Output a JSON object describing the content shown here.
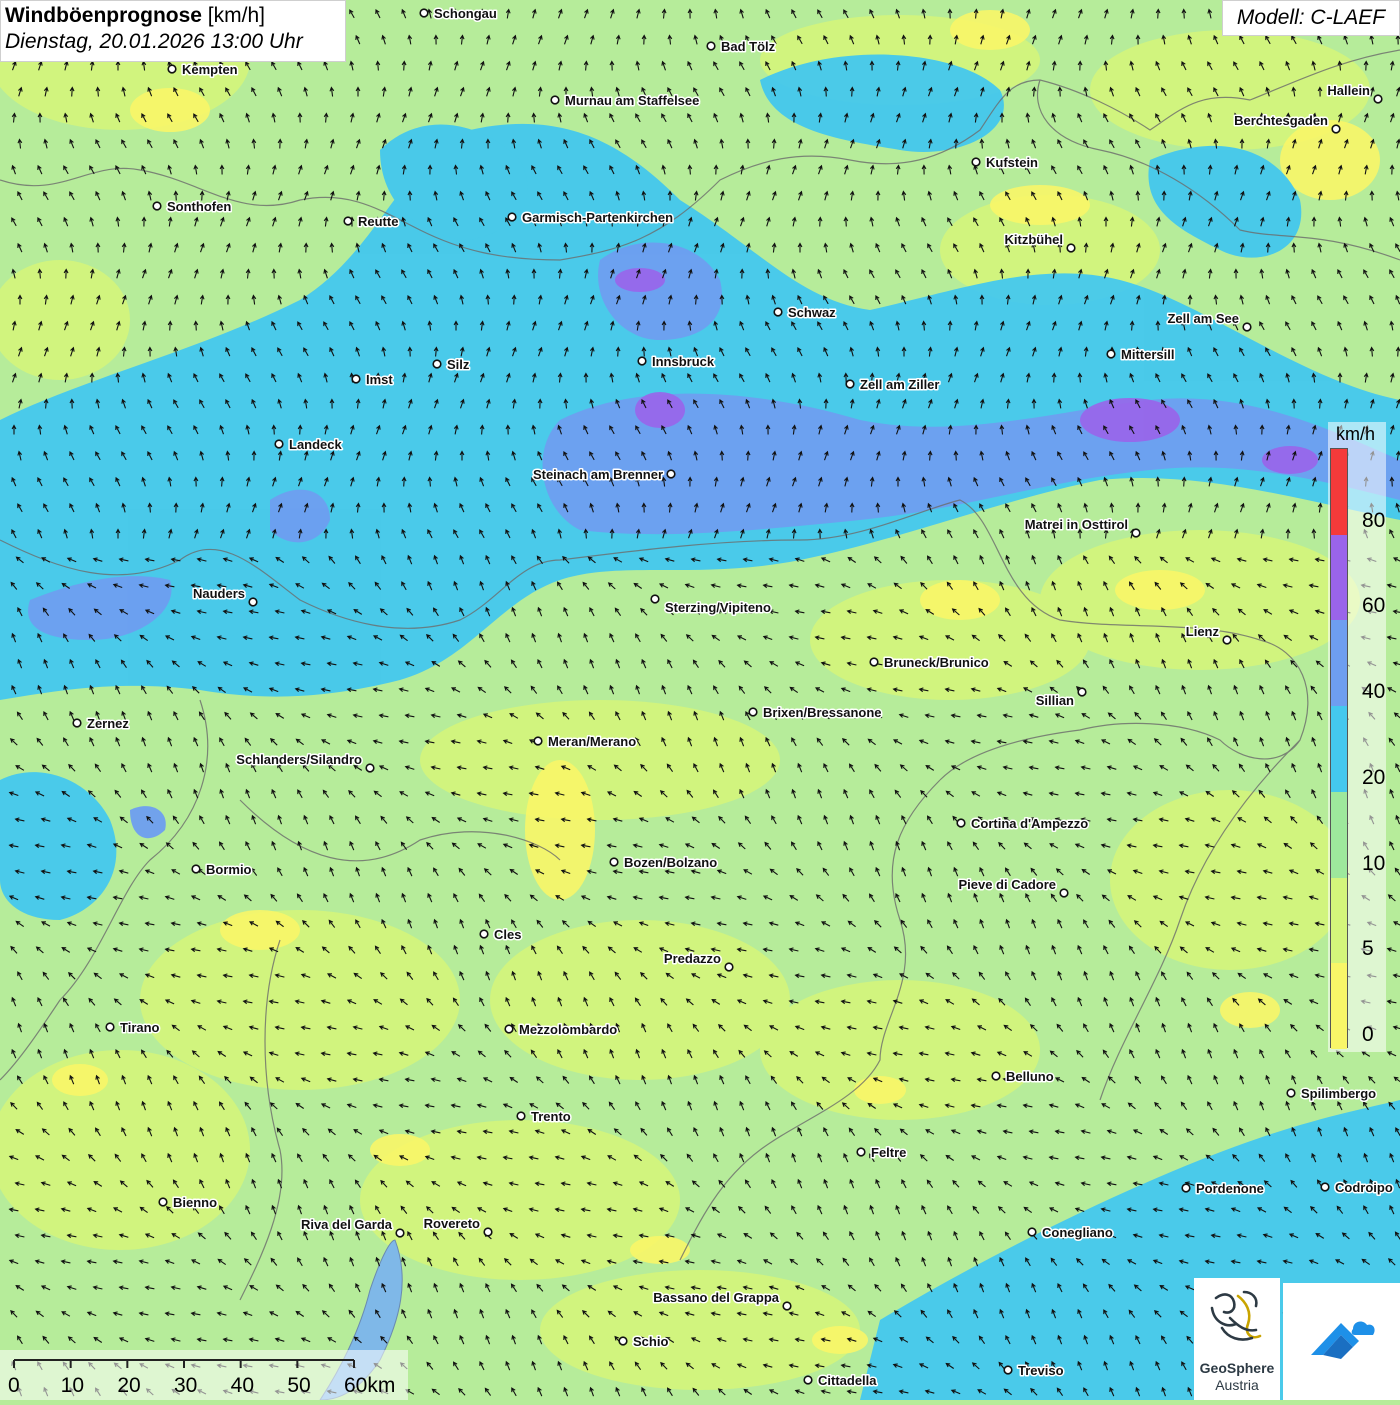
{
  "header": {
    "title_bold": "Windböenprognose",
    "title_unit": " [km/h]",
    "date_line": "Dienstag, 20.01.2026 13:00 Uhr",
    "model": "Modell: C-LAEF"
  },
  "legend": {
    "unit": "km/h",
    "ticks": [
      "0",
      "5",
      "10",
      "20",
      "40",
      "60",
      "80"
    ],
    "colors": [
      "#f8f668",
      "#d4f57b",
      "#9ee89c",
      "#44c8ee",
      "#6e9ef0",
      "#9a64ea",
      "#f43a3a"
    ]
  },
  "scale": {
    "labels": [
      "0",
      "10",
      "20",
      "30",
      "40",
      "50",
      "60km"
    ]
  },
  "logos": {
    "geosphere_line1": "GeoSphere",
    "geosphere_line2": "Austria"
  },
  "cities": [
    {
      "id": "schongau",
      "name": "Schongau"
    },
    {
      "id": "bad-toelz",
      "name": "Bad Tölz"
    },
    {
      "id": "kempten",
      "name": "Kempten"
    },
    {
      "id": "murnau",
      "name": "Murnau am Staffelsee"
    },
    {
      "id": "hallein",
      "name": "Hallein"
    },
    {
      "id": "berchtesgaden",
      "name": "Berchtesgaden"
    },
    {
      "id": "kufstein",
      "name": "Kufstein"
    },
    {
      "id": "sonthofen",
      "name": "Sonthofen"
    },
    {
      "id": "reutte",
      "name": "Reutte"
    },
    {
      "id": "garmisch",
      "name": "Garmisch-Partenkirchen"
    },
    {
      "id": "kitzbuehel",
      "name": "Kitzbühel"
    },
    {
      "id": "schwaz",
      "name": "Schwaz"
    },
    {
      "id": "zell-am-see",
      "name": "Zell am See"
    },
    {
      "id": "mittersill",
      "name": "Mittersill"
    },
    {
      "id": "silz",
      "name": "Silz"
    },
    {
      "id": "innsbruck",
      "name": "Innsbruck"
    },
    {
      "id": "imst",
      "name": "Imst"
    },
    {
      "id": "zell-am-ziller",
      "name": "Zell am Ziller"
    },
    {
      "id": "landeck",
      "name": "Landeck"
    },
    {
      "id": "steinach",
      "name": "Steinach am Brenner"
    },
    {
      "id": "matrei",
      "name": "Matrei in Osttirol"
    },
    {
      "id": "nauders",
      "name": "Nauders"
    },
    {
      "id": "sterzing",
      "name": "Sterzing/Vipiteno"
    },
    {
      "id": "lienz",
      "name": "Lienz"
    },
    {
      "id": "bruneck",
      "name": "Bruneck/Brunico"
    },
    {
      "id": "sillian",
      "name": "Sillian"
    },
    {
      "id": "brixen",
      "name": "Brixen/Bressanone"
    },
    {
      "id": "zernez",
      "name": "Zernez"
    },
    {
      "id": "meran",
      "name": "Meran/Merano"
    },
    {
      "id": "schlanders",
      "name": "Schlanders/Silandro"
    },
    {
      "id": "cortina",
      "name": "Cortina d'Ampezzo"
    },
    {
      "id": "bozen",
      "name": "Bozen/Bolzano"
    },
    {
      "id": "bormio",
      "name": "Bormio"
    },
    {
      "id": "pieve",
      "name": "Pieve di Cadore"
    },
    {
      "id": "cles",
      "name": "Cles"
    },
    {
      "id": "predazzo",
      "name": "Predazzo"
    },
    {
      "id": "tirano",
      "name": "Tirano"
    },
    {
      "id": "mezzolombardo",
      "name": "Mezzolombardo"
    },
    {
      "id": "belluno",
      "name": "Belluno"
    },
    {
      "id": "spilimbergo",
      "name": "Spilimbergo"
    },
    {
      "id": "trento",
      "name": "Trento"
    },
    {
      "id": "feltre",
      "name": "Feltre"
    },
    {
      "id": "pordenone",
      "name": "Pordenone"
    },
    {
      "id": "codroipo",
      "name": "Codroipo"
    },
    {
      "id": "bienno",
      "name": "Bienno"
    },
    {
      "id": "riva",
      "name": "Riva del Garda"
    },
    {
      "id": "rovereto",
      "name": "Rovereto"
    },
    {
      "id": "conegliano",
      "name": "Conegliano"
    },
    {
      "id": "bassano",
      "name": "Bassano del Grappa"
    },
    {
      "id": "schio",
      "name": "Schio"
    },
    {
      "id": "treviso",
      "name": "Treviso"
    },
    {
      "id": "cittadella",
      "name": "Cittadella"
    }
  ]
}
